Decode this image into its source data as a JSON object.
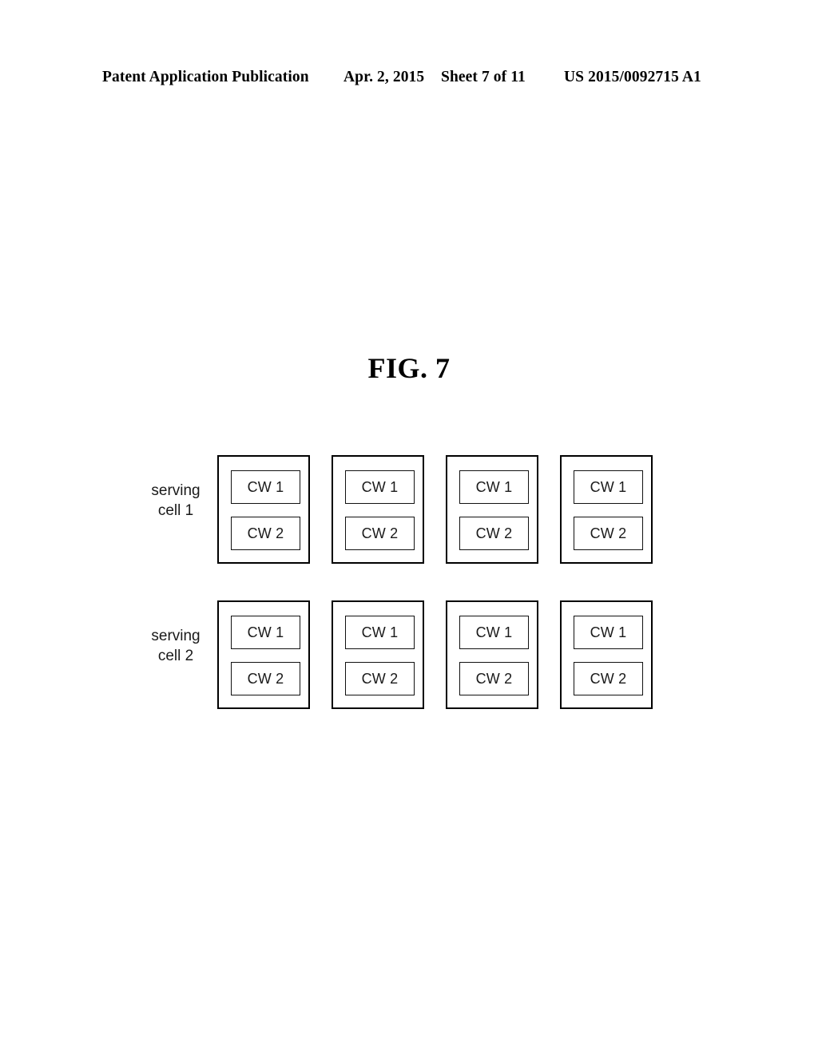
{
  "header": {
    "publication": "Patent Application Publication",
    "date": "Apr. 2, 2015",
    "sheet": "Sheet 7 of 11",
    "number": "US 2015/0092715 A1"
  },
  "figure": {
    "title": "FIG. 7"
  },
  "diagram": {
    "rows": [
      {
        "label_line1": "serving",
        "label_line2": "cell 1",
        "subframes": [
          {
            "codewords": [
              "CW 1",
              "CW 2"
            ]
          },
          {
            "codewords": [
              "CW 1",
              "CW 2"
            ]
          },
          {
            "codewords": [
              "CW 1",
              "CW 2"
            ]
          },
          {
            "codewords": [
              "CW 1",
              "CW 2"
            ]
          }
        ]
      },
      {
        "label_line1": "serving",
        "label_line2": "cell 2",
        "subframes": [
          {
            "codewords": [
              "CW 1",
              "CW 2"
            ]
          },
          {
            "codewords": [
              "CW 1",
              "CW 2"
            ]
          },
          {
            "codewords": [
              "CW 1",
              "CW 2"
            ]
          },
          {
            "codewords": [
              "CW 1",
              "CW 2"
            ]
          }
        ]
      }
    ]
  },
  "colors": {
    "ink": "#000000",
    "paper": "#ffffff"
  }
}
